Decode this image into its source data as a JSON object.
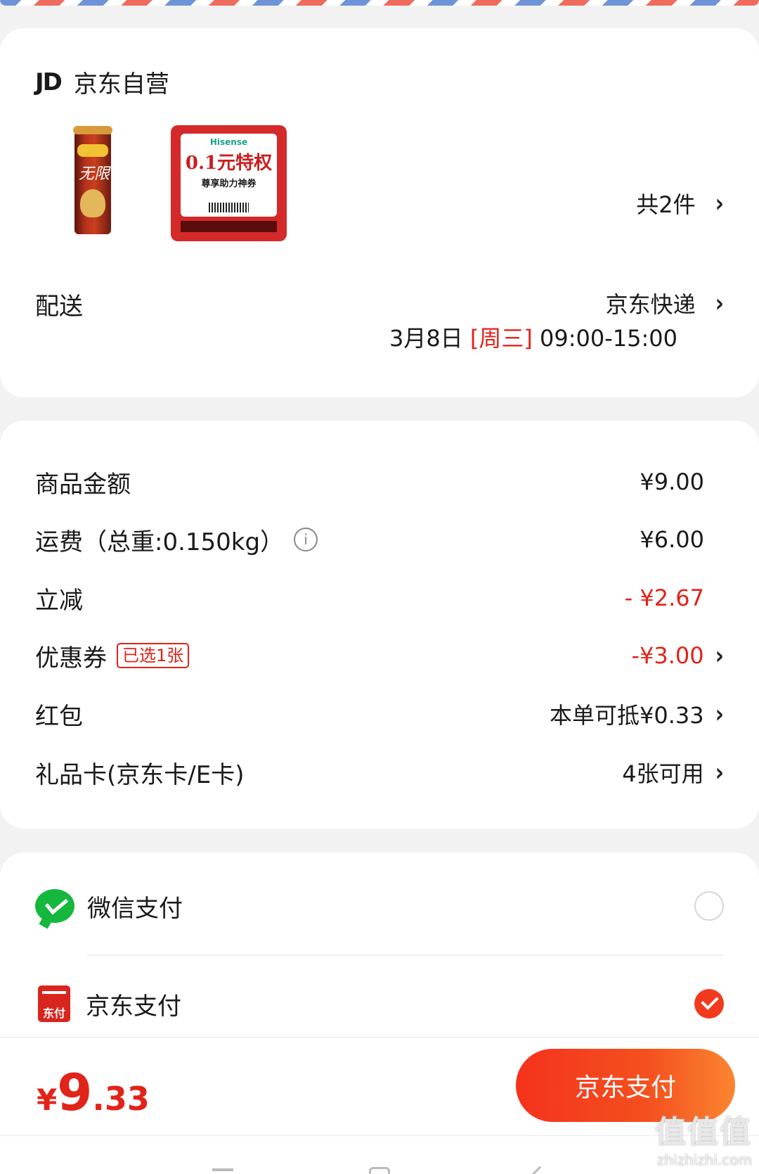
{
  "shop": {
    "logo_text": "JD",
    "name": "京东自营"
  },
  "products": {
    "count_label": "共2件"
  },
  "promo_image": {
    "brand": "Hisense",
    "headline": "0.1元特权",
    "subline": "尊享助力神券"
  },
  "snack_image": {
    "text": "无限"
  },
  "delivery": {
    "label": "配送",
    "method": "京东快递",
    "date": "3月8日",
    "weekday": "[周三]",
    "time": "09:00-15:00"
  },
  "summary": [
    {
      "label": "商品金额",
      "value": "¥9.00"
    },
    {
      "label": "运费（总重:0.150kg）",
      "value": "¥6.00"
    },
    {
      "label": "立减",
      "value": "- ¥2.67"
    },
    {
      "label": "优惠券",
      "tag": "已选1张",
      "value": "-¥3.00"
    },
    {
      "label": "红包",
      "value": "本单可抵¥0.33"
    },
    {
      "label": "礼品卡(京东卡/E卡)",
      "value": "4张可用"
    }
  ],
  "payment_methods": [
    {
      "label": "微信支付",
      "icon": "wechat-icon",
      "selected": false
    },
    {
      "label": "京东支付",
      "icon": "jd-pay-icon",
      "icon_text": "东付",
      "selected": true
    }
  ],
  "total": {
    "currency": "¥",
    "integer": "9",
    "decimal": ".33"
  },
  "pay_button": {
    "label": "京东支付"
  },
  "watermark": {
    "big": "值值值",
    "small": "zhizhizhi.com"
  },
  "colors": {
    "accent": "#e2231a",
    "button_gradient_start": "#f5321c",
    "button_gradient_end": "#fb8530",
    "wechat_green": "#15b83d"
  }
}
